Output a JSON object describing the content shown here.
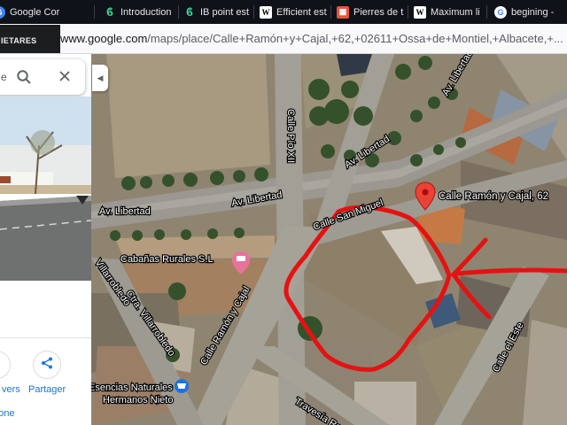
{
  "browser": {
    "tabs": [
      {
        "title": "Google Cor",
        "icon": "google-icon",
        "color": "#4285f4"
      },
      {
        "title": "Introduction",
        "icon": "ib-logo-icon",
        "color": "#3ddc97"
      },
      {
        "title": "IB point est",
        "icon": "ib-logo-icon",
        "color": "#3ddc97"
      },
      {
        "title": "Efficient est",
        "icon": "w-icon",
        "color": "#ffffff"
      },
      {
        "title": "Pierres de t",
        "icon": "pierres-icon",
        "color": "#e8543a"
      },
      {
        "title": "Maximum li",
        "icon": "w-icon",
        "color": "#ffffff"
      },
      {
        "title": "begining -",
        "icon": "google-g-icon",
        "color": "#4285f4"
      }
    ],
    "url_host": "www.google.com",
    "url_path": "/maps/place/Calle+Ramón+y+Cajal,+62,+02611+Ossa+de+Montiel,+Albacete,+..."
  },
  "overlay_logo": "IETARES",
  "map": {
    "labels": {
      "av_libertad_left": "Av. Libertad",
      "av_libertad_mid": "Av. Libertad",
      "av_libertad_diag": "Av. Libertad",
      "av_libertad_top": "Av. Libertad",
      "calle_pio_xii": "Calle Pío XII",
      "calle_san_miguel": "Calle San Miguel",
      "pin_label": "Calle Ramón y Cajal, 62",
      "cabanas": "Cabañas Rurales S.L",
      "villarrobledo_a": "Villarrobledo",
      "villarrobledo_b": "Ctra. Villarrobledo",
      "ramon_cajal": "Calle Ramón y Cajal",
      "calle_este": "Calle el Este",
      "travesia": "Travesía Ramón",
      "esencias_1": "Esencias Naturales",
      "esencias_2": "Hermanos Nieto"
    }
  },
  "panel": {
    "search_text": "e",
    "actions": {
      "share_label": "Partager",
      "send_label_1": "vers",
      "send_label_2": "phone"
    }
  }
}
